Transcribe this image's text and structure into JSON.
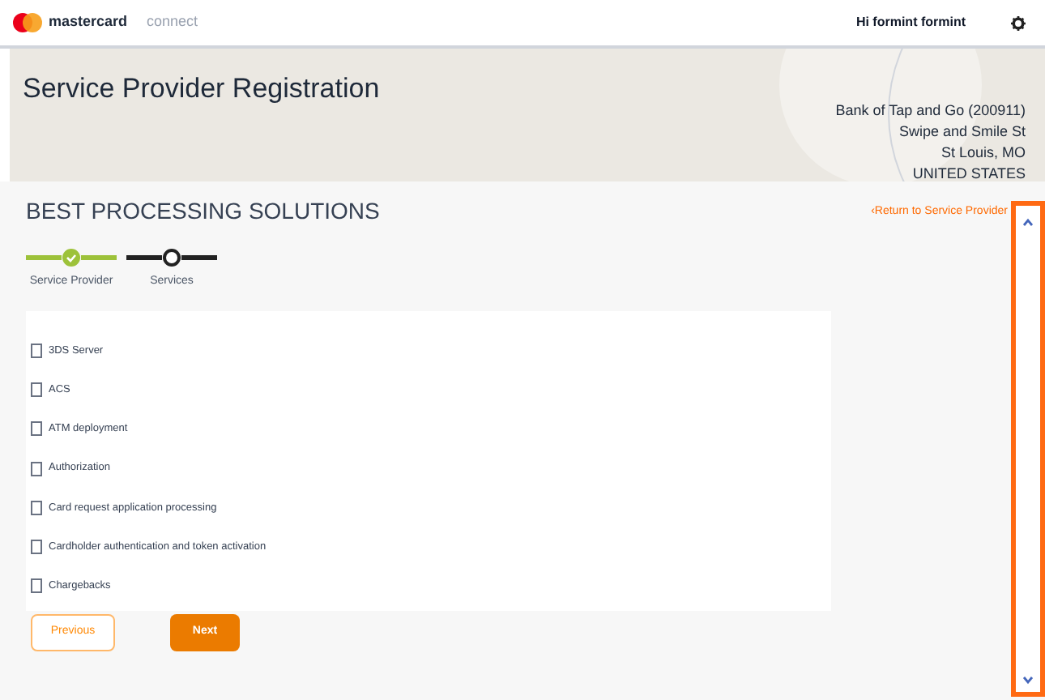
{
  "header": {
    "brand": "mastercard",
    "product": "connect",
    "greeting": "Hi formint formint"
  },
  "banner": {
    "title": "Service Provider Registration",
    "address": [
      "Bank of Tap and Go (200911)",
      "Swipe and Smile St",
      "St Louis, MO",
      "UNITED STATES"
    ]
  },
  "section_title": "BEST PROCESSING SOLUTIONS",
  "return_link": "‹Return to Service Provider",
  "steps": [
    {
      "label": "Service Provider",
      "completed": true
    },
    {
      "label": "Services",
      "completed": false
    }
  ],
  "services": [
    {
      "label": "3DS Server",
      "checked": false
    },
    {
      "label": "ACS",
      "checked": false
    },
    {
      "label": "ATM deployment",
      "checked": false
    },
    {
      "label": "Authorization",
      "checked": false
    },
    {
      "label": "Card request application processing",
      "checked": false
    },
    {
      "label": "Cardholder authentication and token activation",
      "checked": false
    },
    {
      "label": "Chargebacks",
      "checked": false
    }
  ],
  "buttons": {
    "previous": "Previous",
    "next": "Next"
  }
}
